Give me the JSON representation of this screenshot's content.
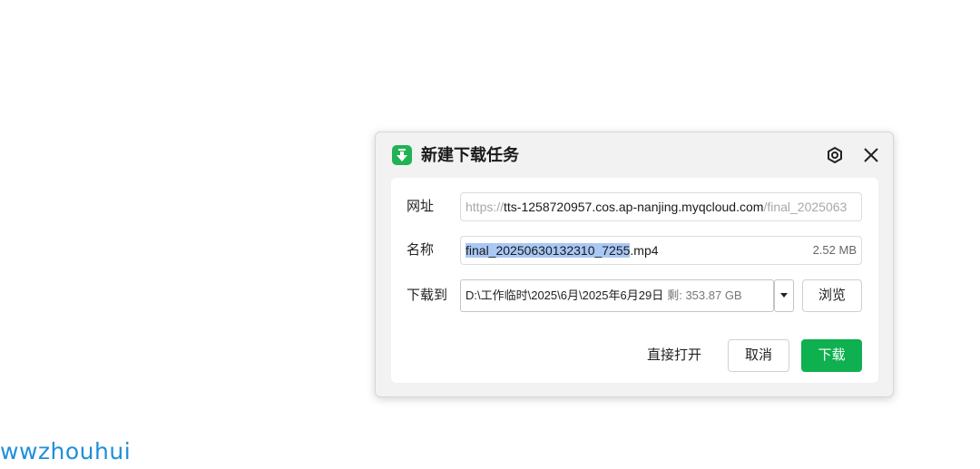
{
  "dialog": {
    "title": "新建下载任务",
    "icons": {
      "app": "download-app-icon",
      "settings": "settings-icon",
      "close": "close-icon"
    },
    "accent_color": "#0fb04f"
  },
  "url_row": {
    "label": "网址",
    "protocol": "https://",
    "host": "tts-1258720957.cos.ap-nanjing.myqcloud.com",
    "path": "/final_2025063"
  },
  "name_row": {
    "label": "名称",
    "selected_name": "final_20250630132310_7255",
    "extension": ".mp4",
    "size": "2.52 MB"
  },
  "save_row": {
    "label": "下载到",
    "path": "D:\\工作临时\\2025\\6月\\2025年6月29日",
    "free_space": "剩: 353.87 GB",
    "browse_label": "浏览"
  },
  "actions": {
    "open_label": "直接打开",
    "cancel_label": "取消",
    "download_label": "下载"
  },
  "watermark": "wwzhouhui"
}
